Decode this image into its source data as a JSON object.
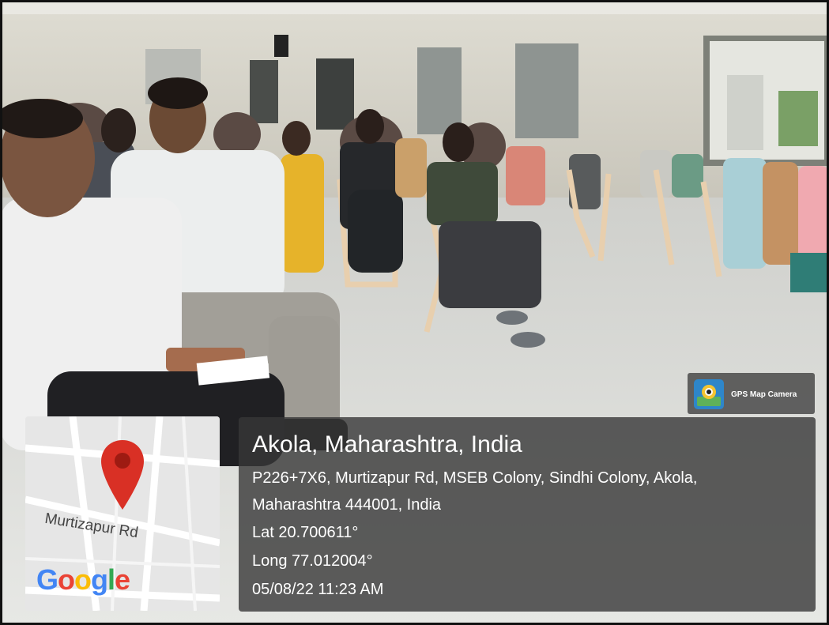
{
  "watermark": {
    "label": "GPS Map Camera",
    "icon": "camera-icon"
  },
  "map": {
    "road_label": "Murtizapur Rd",
    "logo": "Google",
    "pin_color": "#d93025"
  },
  "location": {
    "title": "Akola, Maharashtra, India",
    "address_line1": "P226+7X6, Murtizapur Rd, MSEB Colony, Sindhi Colony, Akola,",
    "address_line2": "Maharashtra 444001, India",
    "lat": "Lat 20.700611°",
    "long": "Long 77.012004°",
    "datetime": "05/08/22 11:23 AM"
  }
}
